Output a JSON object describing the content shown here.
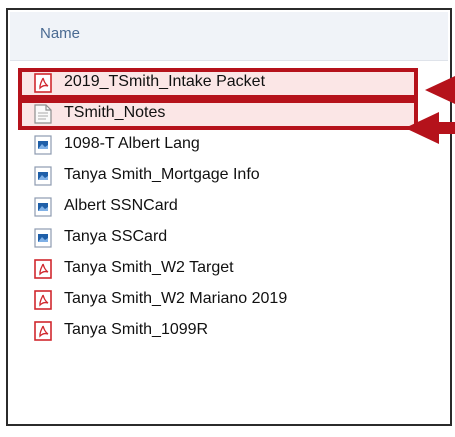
{
  "header": {
    "column_name": "Name"
  },
  "files": [
    {
      "name": "2019_TSmith_Intake Packet",
      "icon": "pdf-icon",
      "highlighted": true
    },
    {
      "name": "TSmith_Notes",
      "icon": "text-file-icon",
      "highlighted": true
    },
    {
      "name": "1098-T Albert Lang",
      "icon": "image-file-icon",
      "highlighted": false
    },
    {
      "name": "Tanya Smith_Mortgage Info",
      "icon": "image-file-icon",
      "highlighted": false
    },
    {
      "name": "Albert SSNCard",
      "icon": "image-file-icon",
      "highlighted": false
    },
    {
      "name": "Tanya SSCard",
      "icon": "image-file-icon",
      "highlighted": false
    },
    {
      "name": "Tanya Smith_W2 Target",
      "icon": "pdf-icon",
      "highlighted": false
    },
    {
      "name": "Tanya Smith_W2 Mariano 2019",
      "icon": "pdf-icon",
      "highlighted": false
    },
    {
      "name": "Tanya Smith_1099R",
      "icon": "pdf-icon",
      "highlighted": false
    }
  ],
  "colors": {
    "highlight_border": "#b5121b",
    "highlight_fill": "#fbe6e6",
    "pdf_icon": "#d0282e",
    "image_icon": "#1f5fa8",
    "header_text": "#4a6a92"
  }
}
